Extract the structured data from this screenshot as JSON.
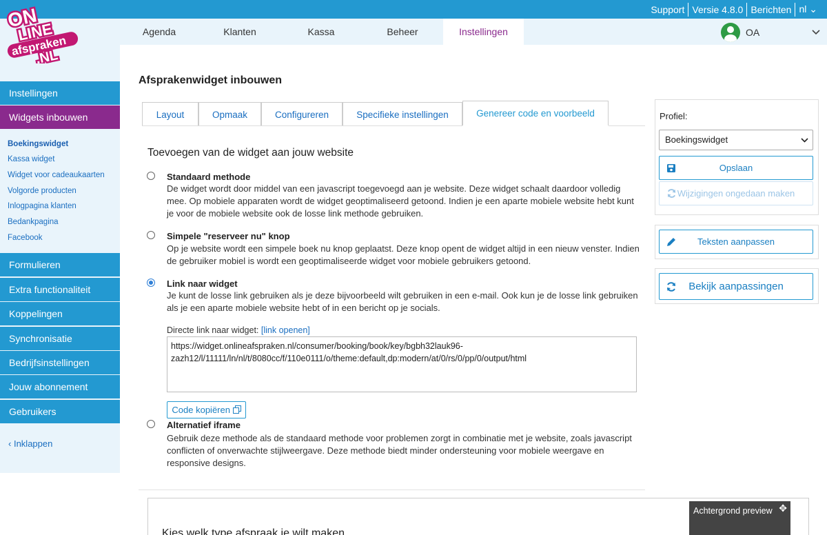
{
  "logo": {
    "line1": "ON",
    "line2": "LINE",
    "line3": "afspraken",
    "line4": ".NL"
  },
  "toplinks": {
    "support": "Support",
    "version": "Versie 4.8.0",
    "messages": "Berichten",
    "language": "nl"
  },
  "nav": {
    "tabs": [
      "Agenda",
      "Klanten",
      "Kassa",
      "Beheer",
      "Instellingen"
    ],
    "active": "Instellingen",
    "user": "OA"
  },
  "sidebar": {
    "settings": "Instellingen",
    "widgets": "Widgets inbouwen",
    "subitems": [
      "Boekingswidget",
      "Kassa widget",
      "Widget voor cadeaukaarten",
      "Volgorde producten",
      "Inlogpagina klanten",
      "Bedankpagina",
      "Facebook"
    ],
    "items": [
      "Formulieren",
      "Extra functionaliteit",
      "Koppelingen",
      "Synchronisatie",
      "Bedrijfsinstellingen",
      "Jouw abonnement",
      "Gebruikers"
    ],
    "collapse": "Inklappen"
  },
  "main": {
    "title": "Afsprakenwidget inbouwen",
    "tabs": [
      "Layout",
      "Opmaak",
      "Configureren",
      "Specifieke instellingen",
      "Genereer code en voorbeeld"
    ],
    "section_title": "Toevoegen van de widget aan jouw website",
    "options": [
      {
        "title": "Standaard methode",
        "desc": "De widget wordt door middel van een javascript toegevoegd aan je website. Deze widget schaalt daardoor volledig mee. Op mobiele apparaten wordt de widget geoptimaliseerd getoond. Indien je een aparte mobiele website hebt kunt je voor de mobiele website ook de losse link methode gebruiken.",
        "checked": false
      },
      {
        "title": "Simpele \"reserveer nu\" knop",
        "desc": "Op je website wordt een simpele boek nu knop geplaatst. Deze knop opent de widget altijd in een nieuw venster. Indien de gebruiker mobiel is wordt een geoptimaliseerde widget voor mobiele gebruikers getoond.",
        "checked": false
      },
      {
        "title": "Link naar widget",
        "desc": "Je kunt de losse link gebruiken als je deze bijvoorbeeld wilt gebruiken in een e-mail. Ook kun je de losse link gebruiken als je een aparte mobiele website hebt of in een bericht op je socials.",
        "checked": true
      },
      {
        "title": "Alternatief iframe",
        "desc": "Gebruik deze methode als de standaard methode voor problemen zorgt in combinatie met je website, zoals javascript conflicten of onverwachte stijlweergave. Deze methode biedt minder ondersteuning voor mobiele weergave en responsive designs.",
        "checked": false
      }
    ],
    "direct_link_label": "Directe link naar widget:",
    "direct_link_open": "[link openen]",
    "url": "https://widget.onlineafspraken.nl/consumer/booking/book/key/bgbh32lauk96-zazh12/l/11111/ln/nl/t/8080cc/f/110e0111/o/theme:default,dp:modern/at/0/rs/0/pp/0/output/html",
    "copy_button": "Code kopiëren",
    "preview_text": "Kies welk type afspraak je wilt maken",
    "bg_preview": "Achtergrond preview"
  },
  "right": {
    "profile_label": "Profiel:",
    "profile_value": "Boekingswidget",
    "save": "Opslaan",
    "undo": "Wijzigingen ongedaan maken",
    "edit_texts": "Teksten aanpassen",
    "view_changes": "Bekijk aanpassingen"
  },
  "colors": {
    "blue": "#2399d1",
    "purple": "#8a2a8d",
    "light_bg": "#e9f4fb"
  }
}
